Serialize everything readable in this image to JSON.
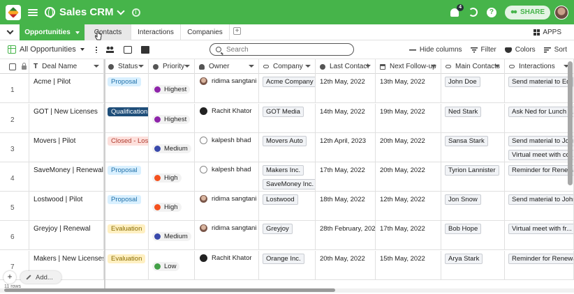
{
  "app": {
    "title": "Sales CRM",
    "notifications": "4",
    "share_label": "SHARE"
  },
  "tabs": {
    "items": [
      "Opportunities",
      "Contacts",
      "Interactions",
      "Companies"
    ],
    "apps_label": "APPS"
  },
  "toolbar": {
    "view_name": "All Opportunities",
    "search_placeholder": "Search",
    "hide_columns": "Hide columns",
    "filter": "Filter",
    "colors": "Colors",
    "sort": "Sort"
  },
  "columns": [
    "Deal Name",
    "Status",
    "Priority",
    "Owner",
    "Company",
    "Last Contact",
    "Next Follow-up",
    "Main Contacts",
    "Interactions"
  ],
  "rows": [
    {
      "num": "1",
      "deal": "Acme | Pilot",
      "status": "Proposal",
      "priority": "Highest",
      "owner": "ridima sangtani",
      "companies": [
        "Acme Company"
      ],
      "last": "12th May, 2022",
      "next": "13th May, 2022",
      "contact": "John Doe",
      "interactions": [
        "Send material to Ed"
      ]
    },
    {
      "num": "2",
      "deal": "GOT | New Licenses",
      "status": "Qualification",
      "priority": "Highest",
      "owner": "Rachit Khator",
      "companies": [
        "GOT Media"
      ],
      "last": "14th May, 2022",
      "next": "19th May, 2022",
      "contact": "Ned Stark",
      "interactions": [
        "Ask Ned for Lunch i..."
      ]
    },
    {
      "num": "3",
      "deal": "Movers | Pilot",
      "status": "Closed - Lost",
      "priority": "Medium",
      "owner": "kalpesh bhad",
      "companies": [
        "Movers Auto"
      ],
      "last": "12th April, 2023",
      "next": "20th May, 2022",
      "contact": "Sansa Stark",
      "interactions": [
        "Send material to John",
        "Virtual meet with co..."
      ]
    },
    {
      "num": "4",
      "deal": "SaveMoney | Renewal",
      "status": "Proposal",
      "priority": "High",
      "owner": "kalpesh bhad",
      "companies": [
        "Makers Inc.",
        "SaveMoney Inc."
      ],
      "last": "17th May, 2022",
      "next": "20th May, 2022",
      "contact": "Tyrion Lannister",
      "interactions": [
        "Reminder for Renewal"
      ]
    },
    {
      "num": "5",
      "deal": "Lostwood | Pilot",
      "status": "Proposal",
      "priority": "High",
      "owner": "ridima sangtani",
      "companies": [
        "Lostwood"
      ],
      "last": "18th May, 2022",
      "next": "12th May, 2022",
      "contact": "Jon Snow",
      "interactions": [
        "Send material to John"
      ]
    },
    {
      "num": "6",
      "deal": "Greyjoy | Renewal",
      "status": "Evaluation",
      "priority": "Medium",
      "owner": "ridima sangtani",
      "companies": [
        "Greyjoy"
      ],
      "last": "28th February, 2023",
      "next": "17th May, 2022",
      "contact": "Bob Hope",
      "interactions": [
        "Virtual meet with fr..."
      ]
    },
    {
      "num": "7",
      "deal": "Makers | New Licenses",
      "status": "Evaluation",
      "priority": "Low",
      "owner": "Rachit Khator",
      "companies": [
        "Orange Inc."
      ],
      "last": "20th May, 2022",
      "next": "15th May, 2022",
      "contact": "Arya Stark",
      "interactions": [
        "Reminder for Renewal"
      ]
    }
  ],
  "footer": {
    "add_label": "Add...",
    "row_count": "11 rows"
  },
  "colors": {
    "brand": "#46b44a",
    "highest": "#8e24aa",
    "medium": "#3949ab",
    "high": "#f4511e",
    "low": "#43a047"
  }
}
